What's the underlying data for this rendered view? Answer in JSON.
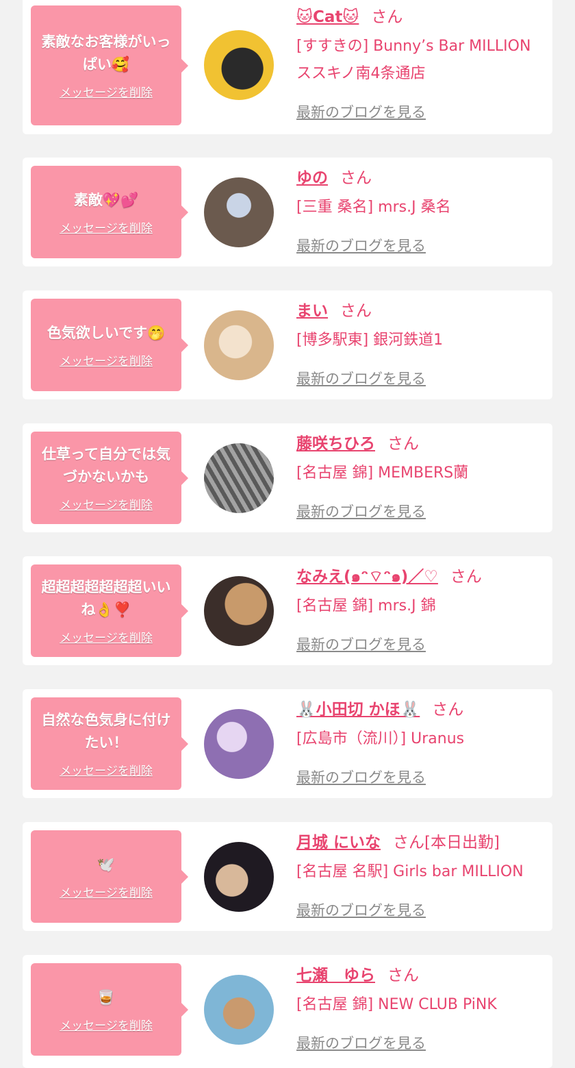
{
  "cards": [
    {
      "message": "素敵なお客様がいっぱい🥰",
      "delete": "メッセージを削除",
      "name": "🐱Cat🐱",
      "san": "さん",
      "shop": "[すすきの] Bunny’s Bar MILLION ススキノ南4条通店",
      "blog": "最新のブログを見る",
      "avatar_colors": [
        "#f1c232",
        "#2a2a2a"
      ]
    },
    {
      "message": "素敵💖💕",
      "delete": "メッセージを削除",
      "name": "ゆの",
      "san": "さん",
      "shop": "[三重 桑名] mrs.J 桑名",
      "blog": "最新のブログを見る",
      "avatar_colors": [
        "#6b5a4e",
        "#c9d4e6"
      ]
    },
    {
      "message": "色気欲しいです🤭",
      "delete": "メッセージを削除",
      "name": "まい",
      "san": "さん",
      "shop": "[博多駅東] 銀河鉄道1",
      "blog": "最新のブログを見る",
      "avatar_colors": [
        "#d9b68c",
        "#f3e2cd"
      ]
    },
    {
      "message": "仕草って自分では気づかないかも",
      "delete": "メッセージを削除",
      "name": "藤咲ちひろ",
      "san": "さん",
      "shop": "[名古屋 錦] MEMBERS蘭",
      "blog": "最新のブログを見る",
      "avatar_colors": [
        "#5a5a5a",
        "#a3a3a3"
      ]
    },
    {
      "message": "超超超超超超超いいね👌❣️",
      "delete": "メッセージを削除",
      "name": "なみえ(๑ᵔ⌔ᵔ๑)／♡",
      "san": "さん",
      "shop": "[名古屋 錦] mrs.J 錦",
      "blog": "最新のブログを見る",
      "avatar_colors": [
        "#c89a6b",
        "#3b2e2a"
      ]
    },
    {
      "message": "自然な色気身に付けたい！",
      "delete": "メッセージを削除",
      "name": "🐰小田切 かほ🐰",
      "san": "さん",
      "shop": "[広島市（流川）] Uranus",
      "blog": "最新のブログを見る",
      "avatar_colors": [
        "#8e6fb2",
        "#e6d6f2"
      ]
    },
    {
      "message": "🕊️",
      "delete": "メッセージを削除",
      "name": "月城 にいな",
      "san": "さん[本日出勤]",
      "shop": "[名古屋 名駅] Girls bar MILLION",
      "blog": "最新のブログを見る",
      "avatar_colors": [
        "#1f1a22",
        "#d8b89a"
      ]
    },
    {
      "message": "🥃",
      "delete": "メッセージを削除",
      "name": "七瀬　ゆら",
      "san": "さん",
      "shop": "[名古屋 錦] NEW CLUB PiNK",
      "blog": "最新のブログを見る",
      "avatar_colors": [
        "#7fb6d6",
        "#c99a6e"
      ]
    }
  ],
  "colors": {
    "accent": "#e8446f",
    "bubble": "#fa96a8",
    "link_gray": "#8a8a8a",
    "background": "#f2f2f2"
  }
}
